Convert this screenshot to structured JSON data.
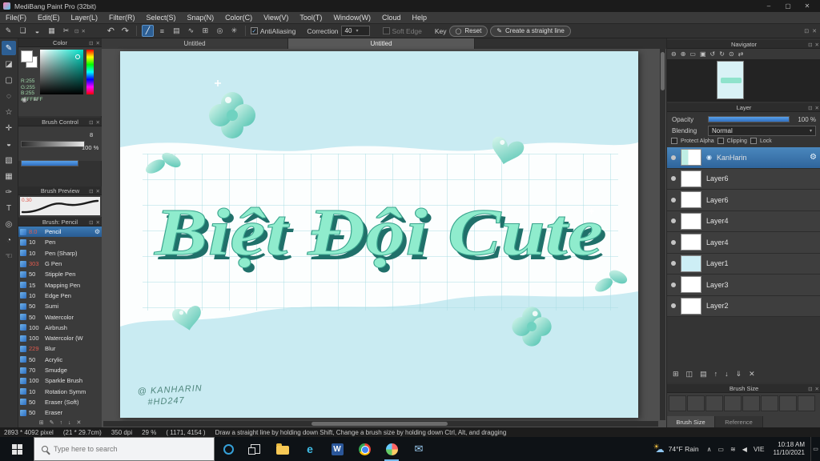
{
  "titlebar": {
    "title": "MediBang Paint Pro (32bit)"
  },
  "menubar": {
    "items": [
      "File(F)",
      "Edit(E)",
      "Layer(L)",
      "Filter(R)",
      "Select(S)",
      "Snap(N)",
      "Color(C)",
      "View(V)",
      "Tool(T)",
      "Window(W)",
      "Cloud",
      "Help"
    ]
  },
  "toolbar": {
    "antialiasing": "AntiAliasing",
    "correction_label": "Correction",
    "correction_value": "40",
    "soft_edge": "Soft Edge",
    "key_label": "Key",
    "reset": "Reset",
    "create_line": "Create a straight line"
  },
  "color_panel": {
    "title": "Color",
    "r": "R:255",
    "g": "G:255",
    "b": "B:255",
    "hex": "#FFFFFF"
  },
  "brush_control": {
    "title": "Brush Control",
    "size_value": "8",
    "opacity_value": "100 %"
  },
  "brush_preview": {
    "title": "Brush Preview",
    "value": "0.30"
  },
  "brush_panel": {
    "title": "Brush: Pencil",
    "items": [
      {
        "size": "8.0",
        "name": "Pencil"
      },
      {
        "size": "10",
        "name": "Pen"
      },
      {
        "size": "10",
        "name": "Pen (Sharp)"
      },
      {
        "size": "303",
        "name": "G Pen"
      },
      {
        "size": "50",
        "name": "Stipple Pen"
      },
      {
        "size": "15",
        "name": "Mapping Pen"
      },
      {
        "size": "10",
        "name": "Edge Pen"
      },
      {
        "size": "50",
        "name": "Sumi"
      },
      {
        "size": "50",
        "name": "Watercolor"
      },
      {
        "size": "100",
        "name": "Airbrush"
      },
      {
        "size": "100",
        "name": "Watercolor (W"
      },
      {
        "size": "229",
        "name": "Blur"
      },
      {
        "size": "50",
        "name": "Acrylic"
      },
      {
        "size": "70",
        "name": "Smudge"
      },
      {
        "size": "100",
        "name": "Sparkle Brush"
      },
      {
        "size": "10",
        "name": "Rotation Symm"
      },
      {
        "size": "50",
        "name": "Eraser (Soft)"
      },
      {
        "size": "50",
        "name": "Eraser"
      }
    ]
  },
  "canvas": {
    "tabs": [
      "Untitled",
      "Untitled"
    ],
    "title_text": "Biệt Đội Cute",
    "signature1": "@ KANHARIN",
    "signature2": "#HD247"
  },
  "navigator": {
    "title": "Navigator"
  },
  "layer_panel": {
    "title": "Layer",
    "opacity_label": "Opacity",
    "opacity_value": "100 %",
    "blending_label": "Blending",
    "blending_value": "Normal",
    "protect_alpha": "Protect Alpha",
    "clipping": "Clipping",
    "lock": "Lock",
    "layers": [
      {
        "name": "KanHarin"
      },
      {
        "name": "Layer6"
      },
      {
        "name": "Layer6"
      },
      {
        "name": "Layer4"
      },
      {
        "name": "Layer4"
      },
      {
        "name": "Layer1"
      },
      {
        "name": "Layer3"
      },
      {
        "name": "Layer2"
      }
    ]
  },
  "brush_size_panel": {
    "title": "Brush Size",
    "tab1": "Brush Size",
    "tab2": "Reference"
  },
  "statusbar": {
    "dimensions": "2893 * 4092 pixel",
    "size_cm": "(21 * 29.7cm)",
    "dpi": "350 dpi",
    "zoom": "29 %",
    "coords": "( 1171, 4154 )",
    "message": "Draw a straight line by holding down Shift, Change a brush size by holding down Ctrl, Alt, and dragging"
  },
  "taskbar": {
    "search_placeholder": "Type here to search",
    "weather": "74°F Rain",
    "language": "VIE",
    "time": "10:18 AM",
    "date": "11/10/2021"
  },
  "colors": {
    "accent_blue": "#2d5f94",
    "selection_blue": "#2a5c92",
    "canvas_bg": "#c9ebf2",
    "artwork_title_fill": "#8feccd",
    "artwork_title_shadow": "#20706a",
    "brush_size_red": "#e05a4e"
  },
  "icons": {
    "minimize": "–",
    "maximize": "▢",
    "close": "✕",
    "collapse": "⊡",
    "pen": "✎",
    "panel": "❏",
    "fill": "◒",
    "mesh": "▦",
    "scissors": "✂",
    "undo": "↶",
    "redo": "↷",
    "line": "╱",
    "parallel": "≡",
    "hatch": "▤",
    "curve": "∿",
    "grid": "⊞",
    "ellipse": "◎",
    "radial": "✳",
    "check": "✓",
    "arrow_down": "▾",
    "circle": "◯",
    "pencil": "✎",
    "tool_brush": "✎",
    "tool_eraser": "◪",
    "tool_select": "▢",
    "tool_lasso": "◌",
    "tool_wand": "☆",
    "tool_move": "✛",
    "tool_fill": "◒",
    "tool_grad": "▧",
    "tool_div": "▦",
    "tool_pen": "✑",
    "tool_text": "T",
    "tool_dropper": "◎",
    "tool_measure": "◔",
    "tool_hand": "☜",
    "zoom_out": "⊖",
    "zoom_in": "⊕",
    "fit": "▭",
    "pixel": "▣",
    "rot_left": "↺",
    "rot_right": "↻",
    "reset_rot": "⊙",
    "flip": "⇄",
    "gear": "⚙",
    "dot": "●",
    "badge": "◉",
    "l_new": "⊞",
    "l_dup": "◫",
    "l_folder": "▤",
    "l_up": "↑",
    "l_down": "↓",
    "l_merge": "⇓",
    "l_del": "✕",
    "b_add": "⊞",
    "b_edit": "✎",
    "b_up": "↑",
    "b_down": "↓",
    "b_del": "✕",
    "chevron_up": "∧",
    "sun": "☀",
    "cloud": "☁",
    "mail": "✉",
    "wifi": "≋",
    "volume": "◀",
    "monitor": "▭",
    "notif": "▭",
    "wheel": "◉",
    "sliders": "≡",
    "edge_letter": "e",
    "word_letter": "W"
  }
}
